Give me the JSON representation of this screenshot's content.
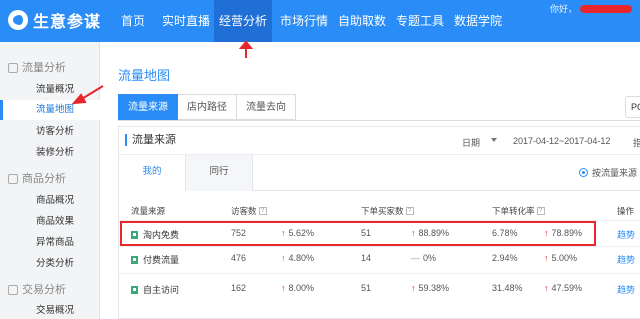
{
  "app": {
    "name": "生意参谋"
  },
  "nav": {
    "items": [
      {
        "label": "首页"
      },
      {
        "label": "实时直播"
      },
      {
        "label": "经营分析"
      },
      {
        "label": "市场行情"
      },
      {
        "label": "自助取数"
      },
      {
        "label": "专题工具"
      },
      {
        "label": "数据学院"
      }
    ],
    "active_index": 2,
    "user_greeting": "你好，"
  },
  "sidebar": {
    "groups": [
      {
        "label": "流量分析",
        "items": [
          {
            "label": "流量概况"
          },
          {
            "label": "流量地图"
          },
          {
            "label": "访客分析"
          },
          {
            "label": "装修分析"
          }
        ]
      },
      {
        "label": "商品分析",
        "items": [
          {
            "label": "商品概况"
          },
          {
            "label": "商品效果"
          },
          {
            "label": "异常商品"
          },
          {
            "label": "分类分析"
          }
        ]
      },
      {
        "label": "交易分析",
        "items": [
          {
            "label": "交易概况"
          }
        ]
      }
    ],
    "active_item": "流量地图"
  },
  "main": {
    "title": "流量地图",
    "tabs": [
      {
        "label": "流量来源"
      },
      {
        "label": "店内路径"
      },
      {
        "label": "流量去向"
      }
    ],
    "active_tab": 0,
    "pc_button": "PC",
    "panel": {
      "title": "流量来源",
      "date_label": "日期",
      "date_range": "2017-04-12~2017-04-12",
      "dim_label": "指",
      "subtabs": [
        {
          "label": "我的"
        },
        {
          "label": "同行"
        }
      ],
      "by_source_label": "按流量来源"
    },
    "table": {
      "headers": [
        "流量来源",
        "访客数",
        "下单买家数",
        "下单转化率",
        "操作"
      ],
      "rows": [
        {
          "source": "淘内免费",
          "visitors": "752",
          "visitors_change": "5.62%",
          "visitors_dir": "up",
          "buyers": "51",
          "buyers_change": "88.89%",
          "buyers_dir": "up",
          "rate": "6.78%",
          "rate_change": "78.89%",
          "rate_dir": "up",
          "action": "趋势"
        },
        {
          "source": "付费流量",
          "visitors": "476",
          "visitors_change": "4.80%",
          "visitors_dir": "up-green",
          "buyers": "14",
          "buyers_change": "0%",
          "buyers_dir": "flat",
          "rate": "2.94%",
          "rate_change": "5.00%",
          "rate_dir": "up",
          "action": "趋势"
        },
        {
          "source": "自主访问",
          "visitors": "162",
          "visitors_change": "8.00%",
          "visitors_dir": "up",
          "buyers": "51",
          "buyers_change": "59.38%",
          "buyers_dir": "up",
          "rate": "31.48%",
          "rate_change": "47.59%",
          "rate_dir": "up",
          "action": "趋势"
        }
      ]
    }
  },
  "colors": {
    "primary": "#2a8cf6",
    "nav_active": "#1f6fd6",
    "annotation": "#e8262c",
    "increase": "#e8262c",
    "increase_green": "#3ca57a"
  }
}
